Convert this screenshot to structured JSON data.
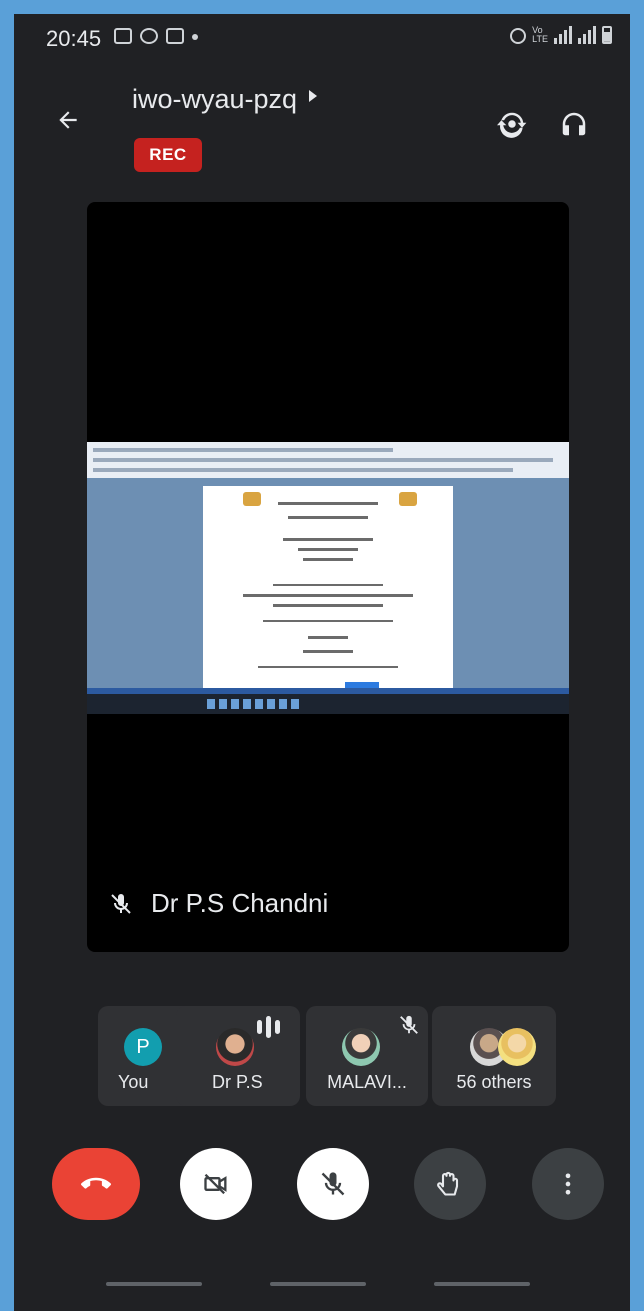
{
  "status_bar": {
    "time": "20:45"
  },
  "header": {
    "meeting_code": "iwo-wyau-pzq",
    "rec_label": "REC"
  },
  "main_tile": {
    "speaker_name": "Dr P.S Chandni"
  },
  "participants": [
    {
      "label": "You",
      "initial": "P"
    },
    {
      "label": "Dr P.S"
    },
    {
      "label": "MALAVI..."
    },
    {
      "label": "56 others"
    }
  ],
  "colors": {
    "end_call": "#ea4335",
    "rec": "#c5221f",
    "avatar_teal": "#129eaf",
    "background": "#202124"
  }
}
